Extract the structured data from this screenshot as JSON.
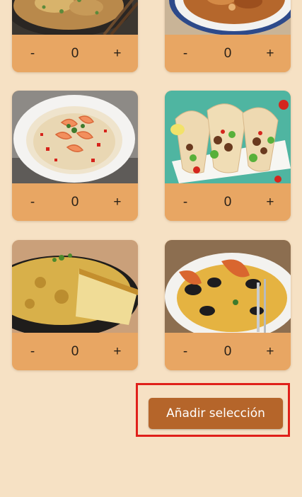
{
  "dishes": [
    {
      "image": "ramen-bowl-image",
      "minus": "-",
      "qty": "0",
      "plus": "+"
    },
    {
      "image": "stew-bowl-image",
      "minus": "-",
      "qty": "0",
      "plus": "+"
    },
    {
      "image": "shrimp-risotto-image",
      "minus": "-",
      "qty": "0",
      "plus": "+"
    },
    {
      "image": "tacos-image",
      "minus": "-",
      "qty": "0",
      "plus": "+"
    },
    {
      "image": "spanish-tortilla-image",
      "minus": "-",
      "qty": "0",
      "plus": "+"
    },
    {
      "image": "paella-image",
      "minus": "-",
      "qty": "0",
      "plus": "+"
    }
  ],
  "actions": {
    "add_selection_label": "Añadir selección"
  },
  "colors": {
    "background": "#f6e1c4",
    "card": "#e8a663",
    "button": "#b5652a",
    "highlight": "#e0201a"
  }
}
